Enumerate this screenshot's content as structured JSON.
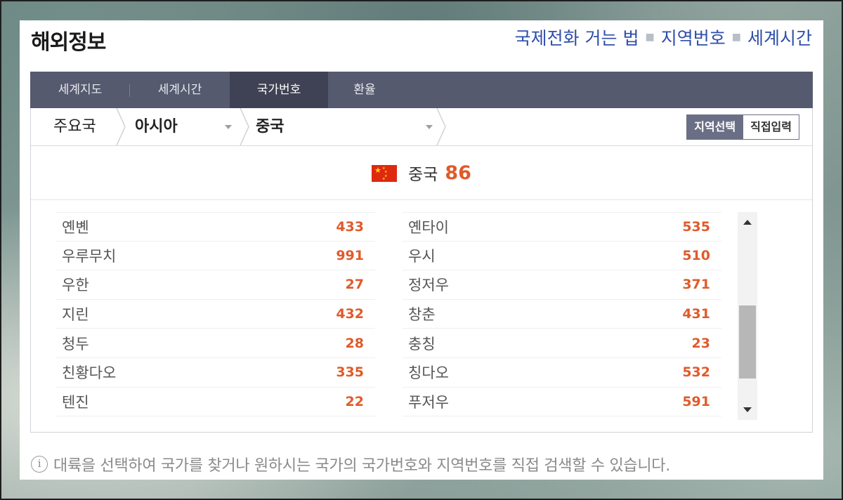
{
  "header": {
    "title": "해외정보",
    "links": [
      "국제전화 거는 법",
      "지역번호",
      "세계시간"
    ]
  },
  "tabs": [
    "세계지도",
    "세계시간",
    "국가번호",
    "환율"
  ],
  "active_tab": "국가번호",
  "breadcrumb": {
    "level1": "주요국",
    "level2": "아시아",
    "level3": "중국"
  },
  "mode_buttons": {
    "select": "지역선택",
    "direct": "직접입력"
  },
  "country": {
    "name": "중국",
    "code": "86",
    "flag_icon": "china-flag-icon"
  },
  "regions_left": [
    {
      "name": "옌볜",
      "code": "433"
    },
    {
      "name": "우루무치",
      "code": "991"
    },
    {
      "name": "우한",
      "code": "27"
    },
    {
      "name": "지린",
      "code": "432"
    },
    {
      "name": "청두",
      "code": "28"
    },
    {
      "name": "친황다오",
      "code": "335"
    },
    {
      "name": "텐진",
      "code": "22"
    }
  ],
  "regions_right": [
    {
      "name": "옌타이",
      "code": "535"
    },
    {
      "name": "우시",
      "code": "510"
    },
    {
      "name": "정저우",
      "code": "371"
    },
    {
      "name": "창춘",
      "code": "431"
    },
    {
      "name": "충칭",
      "code": "23"
    },
    {
      "name": "칭다오",
      "code": "532"
    },
    {
      "name": "푸저우",
      "code": "591"
    }
  ],
  "info_text": "대륙을 선택하여 국가를 찾거나 원하시는 국가의 국가번호와 지역번호를 직접 검색할 수 있습니다.",
  "colors": {
    "accent": "#e05a2a",
    "tab_bar": "#565a6f",
    "tab_active": "#3f4254",
    "link": "#2f4fa8"
  }
}
